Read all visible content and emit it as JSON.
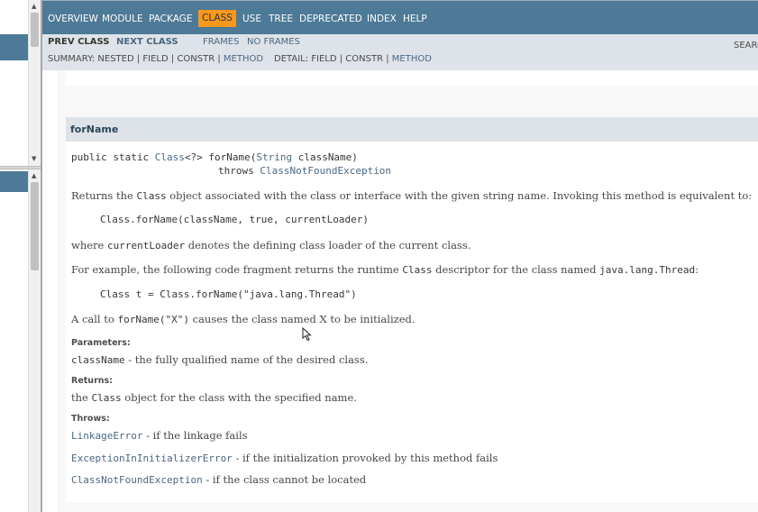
{
  "nav": {
    "items": [
      "OVERVIEW",
      "MODULE",
      "PACKAGE",
      "CLASS",
      "USE",
      "TREE",
      "DEPRECATED",
      "INDEX",
      "HELP"
    ],
    "active": "CLASS",
    "prev_class": "PREV CLASS",
    "next_class": "NEXT CLASS",
    "frames": "FRAMES",
    "no_frames": "NO FRAMES",
    "search_label": "SEARCH:",
    "summary_prefix": "SUMMARY: NESTED | FIELD | CONSTR |",
    "summary_method": "METHOD",
    "detail_prefix": "DETAIL: FIELD | CONSTR |",
    "detail_method": "METHOD"
  },
  "method": {
    "title": "forName",
    "signature": {
      "prefix": "public static ",
      "return_type": "Class",
      "generic": "<?> forName(",
      "param_type": "String",
      "param_name": " className)",
      "throws_word": "throws ",
      "throws_type": "ClassNotFoundException"
    },
    "description": {
      "p1_a": "Returns the ",
      "p1_code": "Class",
      "p1_b": " object associated with the class or interface with the given string name. Invoking this method is equivalent to:",
      "code1": "Class.forName(className, true, currentLoader)",
      "p2_a": "where ",
      "p2_code": "currentLoader",
      "p2_b": " denotes the defining class loader of the current class.",
      "p3_a": "For example, the following code fragment returns the runtime ",
      "p3_code": "Class",
      "p3_b": " descriptor for the class named ",
      "p3_code2": "java.lang.Thread",
      "p3_c": ":",
      "code2": "Class t = Class.forName(\"java.lang.Thread\")",
      "p4_a": "A call to ",
      "p4_code": "forName(\"X\")",
      "p4_b": " causes the class named X to be initialized."
    },
    "parameters_label": "Parameters:",
    "param_name": "className",
    "param_desc": " - the fully qualified name of the desired class.",
    "returns_label": "Returns:",
    "returns_a": "the ",
    "returns_code": "Class",
    "returns_b": " object for the class with the specified name.",
    "throws_label": "Throws:",
    "throws": [
      {
        "name": "LinkageError",
        "desc": " - if the linkage fails"
      },
      {
        "name": "ExceptionInInitializerError",
        "desc": " - if the initialization provoked by this method fails"
      },
      {
        "name": "ClassNotFoundException",
        "desc": " - if the class cannot be located"
      }
    ]
  },
  "colors": {
    "nav_bg": "#4d7a97",
    "active_tab": "#f8981d",
    "subnav_bg": "#dee3e9",
    "link": "#4a6782"
  }
}
